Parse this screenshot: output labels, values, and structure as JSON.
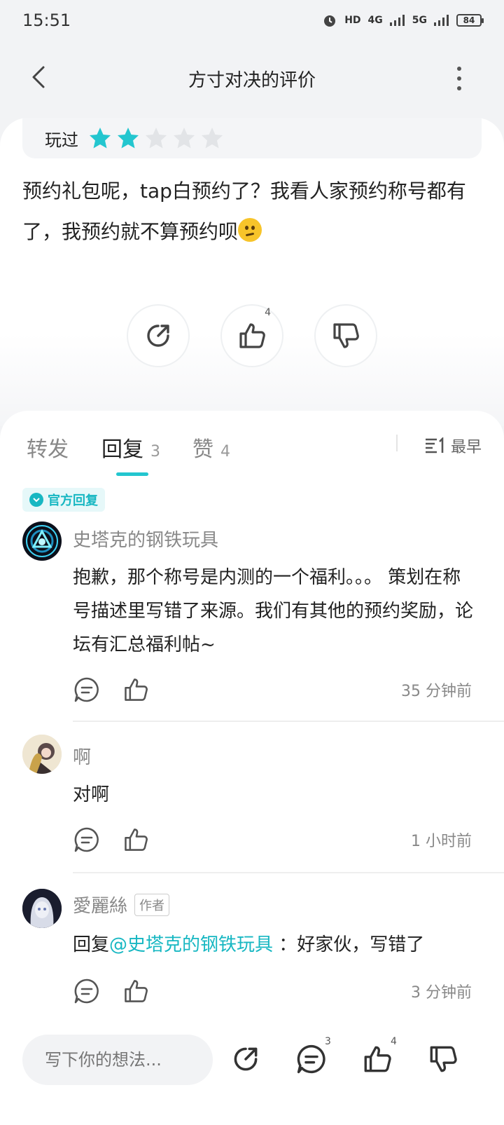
{
  "status_bar": {
    "time": "15:51",
    "indicators": [
      "HD",
      "4G",
      "5G"
    ],
    "battery": "84"
  },
  "header": {
    "title": "方寸对决的评价",
    "back_icon": "back-arrow-icon",
    "more_icon": "more-vertical-icon"
  },
  "review": {
    "played_label": "玩过",
    "rating": 2,
    "max_rating": 5,
    "text": "预约礼包呢，tap白预约了？我看人家预约称号都有了，我预约就不算预约呗",
    "emoji": "confused-face",
    "like_count": "4"
  },
  "tabs": [
    {
      "label": "转发",
      "count": ""
    },
    {
      "label": "回复",
      "count": "3"
    },
    {
      "label": "赞",
      "count": "4"
    }
  ],
  "sort_label": "最早",
  "official_badge": "官方回复",
  "comments": [
    {
      "name": "史塔克的钢铁玩具",
      "body": "抱歉，那个称号是内测的一个福利。。。 策划在称号描述里写错了来源。我们有其他的预约奖励，论坛有汇总福利帖~",
      "time": "35  分钟前"
    },
    {
      "name": "啊",
      "body": "对啊",
      "time": "1  小时前"
    },
    {
      "name": "愛麗絲",
      "author_tag": "作者",
      "body_prefix": "回复",
      "mention": "@史塔克的钢铁玩具",
      "body_rest": " ：好家伙，写错了",
      "time": "3  分钟前"
    }
  ],
  "bottom_bar": {
    "placeholder": "写下你的想法...",
    "comment_count": "3",
    "like_count": "4"
  },
  "colors": {
    "accent": "#23c6cf",
    "star_filled": "#23c6cf",
    "star_empty": "#e2e4e7"
  }
}
